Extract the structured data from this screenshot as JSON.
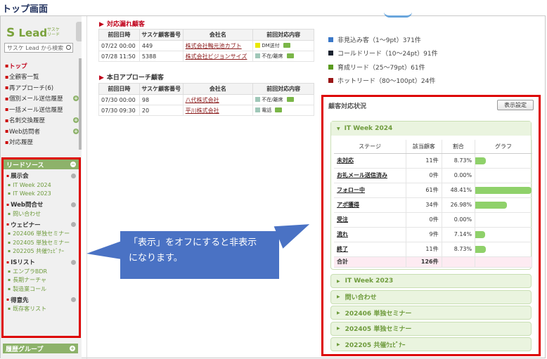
{
  "page_heading": "トップ画面",
  "sidebar": {
    "logo_text": "Lead",
    "logo_sub": "サスケ リード",
    "search_placeholder": "サスケ Lead から検索",
    "nav": [
      {
        "label": "トップ",
        "plus": false
      },
      {
        "label": "全顧客一覧",
        "plus": false
      },
      {
        "label": "再アプローチ(6)",
        "plus": false
      },
      {
        "label": "個別メール送信履歴",
        "plus": true
      },
      {
        "label": "一括メール送信履歴",
        "plus": false
      },
      {
        "label": "名刺交換履歴",
        "plus": true
      },
      {
        "label": "Web訪問者",
        "plus": true
      },
      {
        "label": "対応履歴",
        "plus": false
      }
    ],
    "lead_source_title": "リードソース",
    "lead_groups": [
      {
        "name": "展示会",
        "items": [
          "IT Week 2024",
          "IT Week 2023"
        ]
      },
      {
        "name": "Web問合せ",
        "items": [
          "問い合わせ"
        ]
      },
      {
        "name": "ウェビナー",
        "items": [
          "202406 単独セミナー",
          "202405 単独セミナー",
          "202205 共催ｳｪﾋﾞﾅｰ"
        ]
      },
      {
        "name": "ISリスト",
        "items": [
          "エンプラBDR",
          "長期ナーチャ",
          "製造業コール"
        ]
      },
      {
        "name": "得意先",
        "items": [
          "既存客リスト"
        ]
      }
    ],
    "history_group_title": "履歴グループ"
  },
  "missed": {
    "title": "対応漏れ顧客",
    "headers": [
      "前回日時",
      "サスケ顧客番号",
      "会社名",
      "前回対応内容"
    ],
    "rows": [
      {
        "date": "07/22 00:00",
        "num": "449",
        "company": "株式会社鴨元池カブト",
        "status": "DM送付",
        "color": "#e8e800"
      },
      {
        "date": "07/28 11:50",
        "num": "5388",
        "company": "株式会社ビジョンサイズ",
        "status": "不在/離席",
        "color": "#9fc7b8"
      }
    ]
  },
  "today": {
    "title": "本日アプローチ顧客",
    "headers": [
      "前回日時",
      "サスケ顧客番号",
      "会社名",
      "前回対応内容"
    ],
    "rows": [
      {
        "date": "07/30 00:00",
        "num": "98",
        "company": "八代株式会社",
        "status": "不在/離席",
        "color": "#9fc7b8"
      },
      {
        "date": "07/30 09:30",
        "num": "20",
        "company": "平川株式会社",
        "status": "電話",
        "color": "#9fc7b8"
      }
    ]
  },
  "legend": [
    {
      "label": "非見込み客（1〜9pt）371件",
      "color": "#3b78c8"
    },
    {
      "label": "コールドリード（10〜24pt）91件",
      "color": "#1a2230"
    },
    {
      "label": "育成リード（25〜79pt）61件",
      "color": "#5a9a1e"
    },
    {
      "label": "ホットリード（80〜100pt）24件",
      "color": "#9a1616"
    }
  ],
  "status_panel": {
    "title": "顧客対応状況",
    "settings_button": "表示設定",
    "open_group": "IT Week 2024",
    "columns": [
      "ステージ",
      "該当顧客",
      "割合",
      "グラフ"
    ],
    "stages": [
      {
        "stage": "未対応",
        "count": "11件",
        "pct": "8.73%",
        "ratio": 0.0873
      },
      {
        "stage": "お礼メール送信済み",
        "count": "0件",
        "pct": "0.00%",
        "ratio": 0
      },
      {
        "stage": "フォロー中",
        "count": "61件",
        "pct": "48.41%",
        "ratio": 0.4841
      },
      {
        "stage": "アポ獲得",
        "count": "34件",
        "pct": "26.98%",
        "ratio": 0.2698
      },
      {
        "stage": "受注",
        "count": "0件",
        "pct": "0.00%",
        "ratio": 0
      },
      {
        "stage": "流れ",
        "count": "9件",
        "pct": "7.14%",
        "ratio": 0.0714
      },
      {
        "stage": "終了",
        "count": "11件",
        "pct": "8.73%",
        "ratio": 0.0873
      }
    ],
    "total_label": "合計",
    "total_count": "126件",
    "collapsed_groups": [
      "IT Week 2023",
      "問い合わせ",
      "202406 単独セミナー",
      "202405 単独セミナー",
      "202205 共催ｳｪﾋﾞﾅｰ"
    ]
  },
  "callout": {
    "line1": "「表示」をオフにすると非表示",
    "line2": "になります。"
  }
}
